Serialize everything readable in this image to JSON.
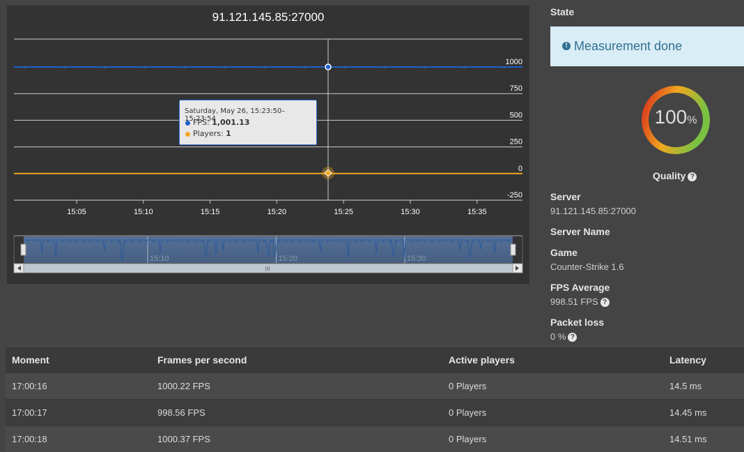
{
  "chart": {
    "title": "91.121.145.85:27000",
    "y_ticks": [
      "1000",
      "750",
      "500",
      "250",
      "0",
      "-250"
    ],
    "x_ticks": [
      "15:05",
      "15:10",
      "15:15",
      "15:20",
      "15:25",
      "15:30",
      "15:35"
    ],
    "navigator_ticks": [
      "15:10",
      "15:20",
      "15:30"
    ],
    "tooltip": {
      "header": "Saturday, May 26, 15:23:50–15:23:54",
      "fps_label": "FPS:",
      "fps_value": "1,001.13",
      "players_label": "Players:",
      "players_value": "1"
    },
    "navigator_scroll_grip": "III"
  },
  "chart_data": {
    "type": "line",
    "title": "91.121.145.85:27000",
    "x_range": [
      "15:00",
      "15:38"
    ],
    "ylim": [
      -250,
      1000
    ],
    "grid": true,
    "series": [
      {
        "name": "FPS",
        "color": "#1e5fd0",
        "approx_value": 1000,
        "values": [
          1000,
          1000,
          998,
          1000,
          1001,
          1000,
          997,
          1000,
          1000,
          1001,
          1000,
          999,
          1000,
          1000
        ]
      },
      {
        "name": "Players",
        "color": "#f0a81e",
        "approx_value": 1,
        "values": [
          0,
          0,
          0,
          0,
          0,
          0,
          0,
          1,
          0,
          0,
          0,
          0,
          0,
          0
        ]
      }
    ],
    "highlight": {
      "time": "15:23:50–15:23:54",
      "FPS": 1001.13,
      "Players": 1
    }
  },
  "state": {
    "label": "State",
    "message": "Measurement done",
    "alert_icon": "!"
  },
  "quality": {
    "percent": "100",
    "unit": "%",
    "label": "Quality",
    "help_icon": "?",
    "fill_fraction": 1.0,
    "gradient_colors": [
      "#d9301e",
      "#f0a81e",
      "#7ac142"
    ]
  },
  "info": {
    "server_label": "Server",
    "server_value": "91.121.145.85:27000",
    "server_name_label": "Server Name",
    "game_label": "Game",
    "game_value": "Counter-Strike 1.6",
    "fps_avg_label": "FPS Average",
    "fps_avg_value": "998.51 FPS",
    "packet_loss_label": "Packet loss",
    "packet_loss_value": "0 %"
  },
  "table": {
    "headers": [
      "Moment",
      "Frames per second",
      "Active players",
      "Latency"
    ],
    "rows": [
      [
        "17:00:16",
        "1000.22 FPS",
        "0 Players",
        "14.5 ms"
      ],
      [
        "17:00:17",
        "998.56 FPS",
        "0 Players",
        "14.45 ms"
      ],
      [
        "17:00:18",
        "1000.37 FPS",
        "0 Players",
        "14.51 ms"
      ]
    ]
  }
}
